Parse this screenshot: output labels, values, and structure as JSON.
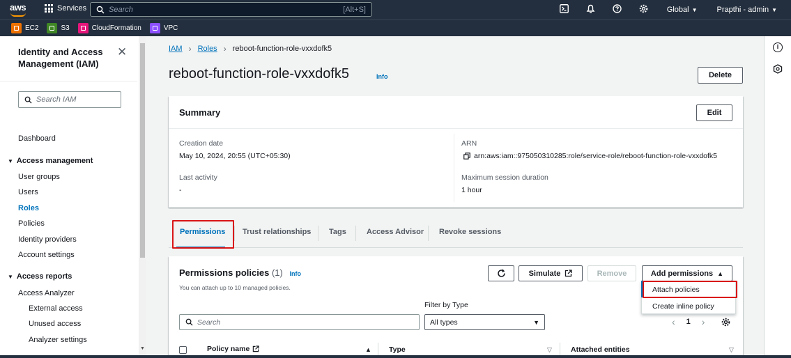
{
  "topnav": {
    "logo": "aws",
    "services_label": "Services",
    "search_placeholder": "Search",
    "search_shortcut": "[Alt+S]",
    "region": "Global",
    "user": "Prapthi - admin",
    "icons": [
      "cloudshell-icon",
      "bell-icon",
      "help-icon",
      "gear-icon"
    ]
  },
  "favorites": [
    {
      "label": "EC2",
      "color": "#ed7100"
    },
    {
      "label": "S3",
      "color": "#3f8624"
    },
    {
      "label": "CloudFormation",
      "color": "#e7157b"
    },
    {
      "label": "VPC",
      "color": "#8c4fff"
    }
  ],
  "sidebar": {
    "title": "Identity and Access Management (IAM)",
    "search_placeholder": "Search IAM",
    "dashboard": "Dashboard",
    "access_management": "Access management",
    "user_groups": "User groups",
    "users": "Users",
    "roles": "Roles",
    "policies": "Policies",
    "identity_providers": "Identity providers",
    "account_settings": "Account settings",
    "access_reports": "Access reports",
    "access_analyzer": "Access Analyzer",
    "external_access": "External access",
    "unused_access": "Unused access",
    "analyzer_settings": "Analyzer settings"
  },
  "breadcrumb": {
    "iam": "IAM",
    "roles": "Roles",
    "current": "reboot-function-role-vxxdofk5"
  },
  "page": {
    "title": "reboot-function-role-vxxdofk5",
    "info": "Info",
    "delete": "Delete"
  },
  "summary": {
    "heading": "Summary",
    "edit": "Edit",
    "creation_date_label": "Creation date",
    "creation_date": "May 10, 2024, 20:55 (UTC+05:30)",
    "last_activity_label": "Last activity",
    "last_activity": "-",
    "arn_label": "ARN",
    "arn": "arn:aws:iam::975050310285:role/service-role/reboot-function-role-vxxdofk5",
    "max_session_label": "Maximum session duration",
    "max_session": "1 hour"
  },
  "tabs": [
    "Permissions",
    "Trust relationships",
    "Tags",
    "Access Advisor",
    "Revoke sessions"
  ],
  "permissions": {
    "title": "Permissions policies",
    "count": "(1)",
    "info": "Info",
    "hint": "You can attach up to 10 managed policies.",
    "simulate": "Simulate",
    "remove": "Remove",
    "add_permissions": "Add permissions",
    "menu": [
      "Attach policies",
      "Create inline policy"
    ],
    "filter_label": "Filter by Type",
    "search_placeholder": "Search",
    "type_selected": "All types",
    "page": "1",
    "columns": [
      "Policy name",
      "Type",
      "Attached entities"
    ]
  },
  "colors": {
    "nav_bg": "#232f3e",
    "link": "#0073bb",
    "highlight": "#d91515"
  }
}
